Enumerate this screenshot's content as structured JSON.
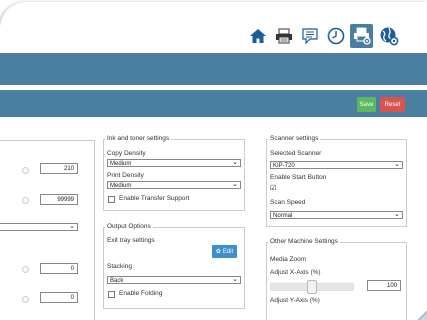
{
  "toolbar": {
    "icons": [
      "home-icon",
      "printer-icon",
      "message-icon",
      "clock-icon",
      "printer-settings-icon",
      "globe-settings-icon"
    ]
  },
  "actions": {
    "save_label": "Save",
    "reset_label": "Reset"
  },
  "left_column": {
    "field1_value": "210",
    "field2_value": "99999",
    "field3_value": "0",
    "field4_value": "0"
  },
  "ink_toner": {
    "title": "Ink and toner settings",
    "copy_density_label": "Copy Density",
    "copy_density_value": "Medium",
    "print_density_label": "Print Density",
    "print_density_value": "Medium",
    "transfer_label": "Enable Transfer Support"
  },
  "output_options": {
    "title": "Output Options",
    "exit_tray_label": "Exit tray settings",
    "edit_label": "Edit",
    "stacking_label": "Stacking",
    "stacking_value": "Back",
    "folding_label": "Enable Folding"
  },
  "scanner": {
    "title": "Scanner settings",
    "selected_label": "Selected Scanner",
    "selected_value": "KIP-720",
    "start_button_label": "Enable Start Button",
    "scan_speed_label": "Scan Speed",
    "scan_speed_value": "Normal"
  },
  "other": {
    "title": "Other Machine Settings",
    "media_zoom_label": "Media Zoom",
    "adjust_x_label": "Adjust X-Axis (%)",
    "adjust_x_value": "100",
    "adjust_y_label": "Adjust Y-Axis (%)"
  },
  "colors": {
    "bar": "#4a7fa1",
    "save": "#5cb85c",
    "reset": "#d9534f",
    "edit": "#3c8fd1"
  }
}
